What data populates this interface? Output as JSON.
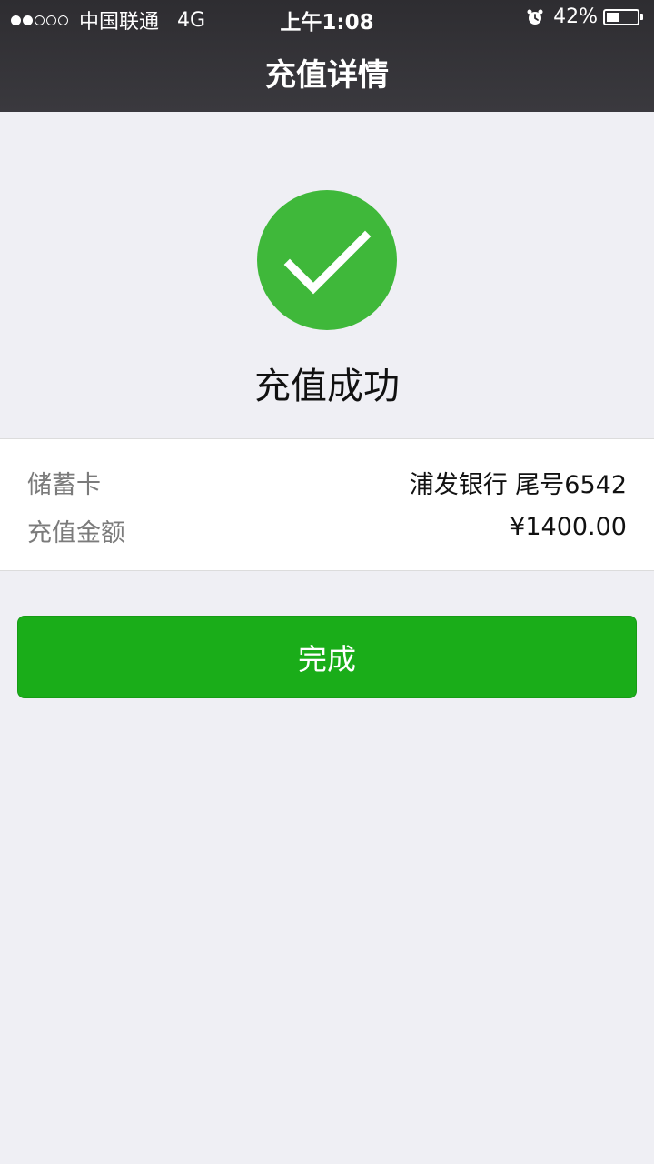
{
  "status_bar": {
    "carrier": "中国联通",
    "network": "4G",
    "time": "上午1:08",
    "battery": "42%",
    "battery_level": 0.42,
    "signal_bars_filled": 2,
    "signal_bars_total": 5
  },
  "nav": {
    "title": "充值详情"
  },
  "result": {
    "icon": "check-circle-icon",
    "color": "#3fb83a",
    "title": "充值成功"
  },
  "details": [
    {
      "label": "储蓄卡",
      "value": "浦发银行 尾号6542"
    },
    {
      "label": "充值金额",
      "value": "¥1400.00"
    }
  ],
  "actions": {
    "done_label": "完成",
    "color": "#1aad19"
  }
}
